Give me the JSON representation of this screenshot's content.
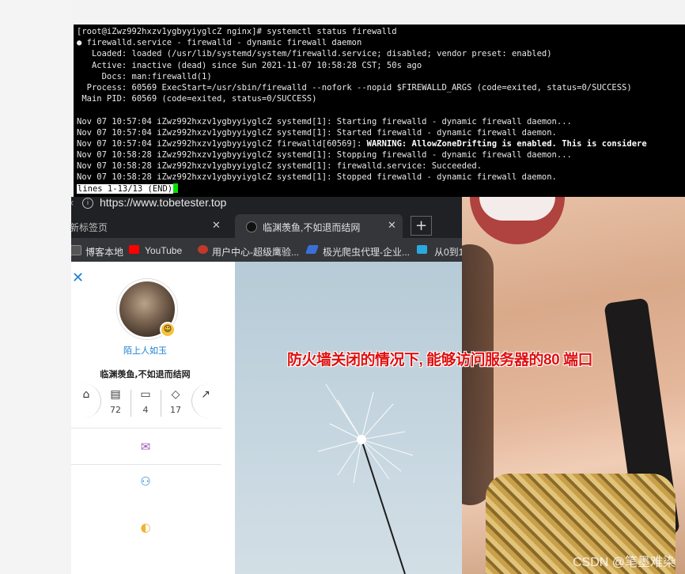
{
  "terminal": {
    "lines": [
      "[root@iZwz992hxzv1ygbyyiyglcZ nginx]# systemctl status firewalld",
      "● firewalld.service - firewalld - dynamic firewall daemon",
      "   Loaded: loaded (/usr/lib/systemd/system/firewalld.service; disabled; vendor preset: enabled)",
      "   Active: inactive (dead) since Sun 2021-11-07 10:58:28 CST; 50s ago",
      "     Docs: man:firewalld(1)",
      "  Process: 60569 ExecStart=/usr/sbin/firewalld --nofork --nopid $FIREWALLD_ARGS (code=exited, status=0/SUCCESS)",
      " Main PID: 60569 (code=exited, status=0/SUCCESS)",
      "",
      "Nov 07 10:57:04 iZwz992hxzv1ygbyyiyglcZ systemd[1]: Starting firewalld - dynamic firewall daemon...",
      "Nov 07 10:57:04 iZwz992hxzv1ygbyyiyglcZ systemd[1]: Started firewalld - dynamic firewall daemon.",
      "",
      "Nov 07 10:58:28 iZwz992hxzv1ygbyyiyglcZ systemd[1]: Stopping firewalld - dynamic firewall daemon...",
      "Nov 07 10:58:28 iZwz992hxzv1ygbyyiyglcZ systemd[1]: firewalld.service: Succeeded.",
      "Nov 07 10:58:28 iZwz992hxzv1ygbyyiyglcZ systemd[1]: Stopped firewalld - dynamic firewall daemon."
    ],
    "warning_prefix": "Nov 07 10:57:04 iZwz992hxzv1ygbyyiyglcZ firewalld[60569]: ",
    "warning_bold": "WARNING: AllowZoneDrifting is enabled. This is considere",
    "pager_status": "lines 1-13/13 (END)"
  },
  "browser": {
    "url": "https://www.tobetester.top",
    "tabs": [
      {
        "label": "新标签页"
      },
      {
        "label": "临渊羡鱼,不如退而结网"
      }
    ],
    "new_tab_symbol": "+",
    "close_symbol": "✕",
    "bookmarks": [
      {
        "label": "博客本地"
      },
      {
        "label": "YouTube"
      },
      {
        "label": "用户中心-超级鹰验..."
      },
      {
        "label": "极光爬虫代理-企业..."
      },
      {
        "label": "从0到1"
      }
    ]
  },
  "sidebar": {
    "close_symbol": "✕",
    "username": "陌上人如玉",
    "motto": "临渊羡鱼,不如退而结网",
    "stats": [
      {
        "icon": "home-icon",
        "value": ""
      },
      {
        "icon": "archive-icon",
        "value": "72"
      },
      {
        "icon": "folder-icon",
        "value": "4"
      },
      {
        "icon": "tag-icon",
        "value": "17"
      },
      {
        "icon": "share-icon",
        "value": ""
      }
    ]
  },
  "annotation": "防火墙关闭的情况下, 能够访问服务器的80 端口",
  "watermark": "CSDN @笔墨难染",
  "colors": {
    "terminal_bg": "#000000",
    "cursor": "#00e000",
    "accent_blue": "#1a7fd6",
    "annotation_red": "#e01010"
  }
}
